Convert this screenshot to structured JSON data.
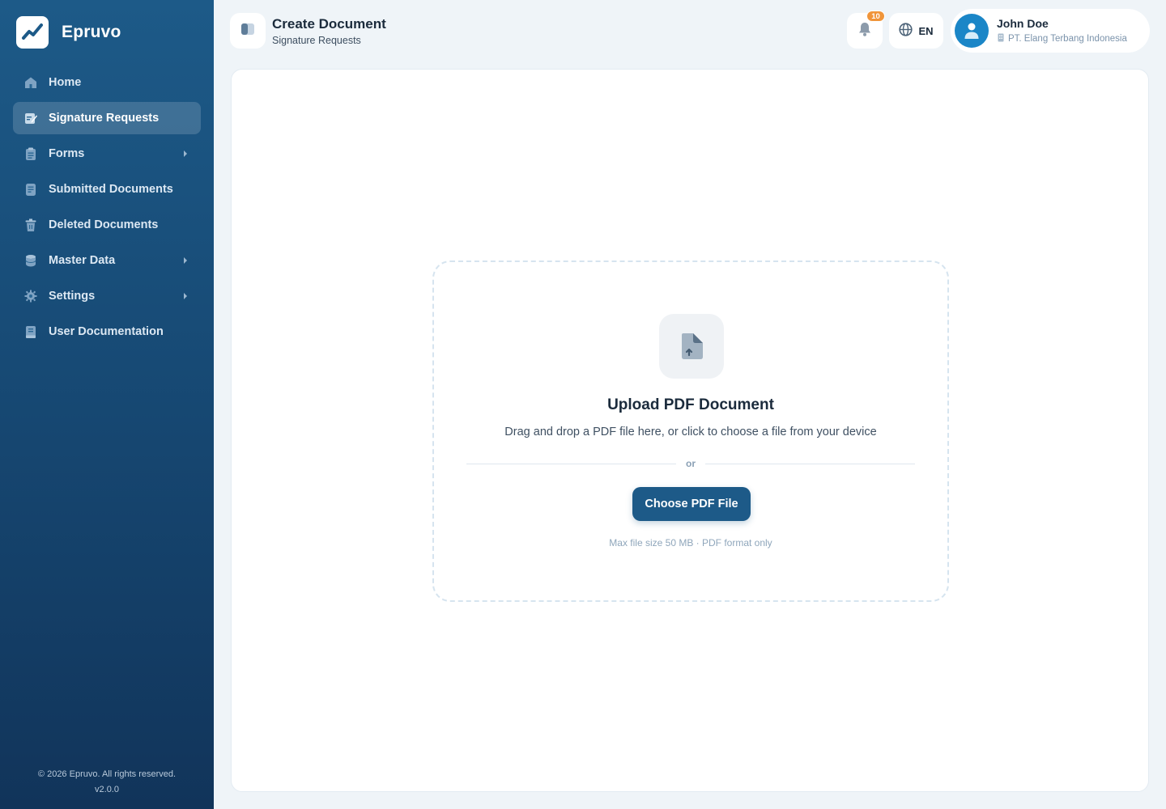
{
  "brand": {
    "name": "Epruvo"
  },
  "sidebar": {
    "items": [
      {
        "label": "Home",
        "icon": "home-icon",
        "active": false,
        "has_submenu": false
      },
      {
        "label": "Signature Requests",
        "icon": "signature-icon",
        "active": true,
        "has_submenu": false
      },
      {
        "label": "Forms",
        "icon": "clipboard-icon",
        "active": false,
        "has_submenu": true
      },
      {
        "label": "Submitted Documents",
        "icon": "document-icon",
        "active": false,
        "has_submenu": false
      },
      {
        "label": "Deleted Documents",
        "icon": "trash-icon",
        "active": false,
        "has_submenu": false
      },
      {
        "label": "Master Data",
        "icon": "database-icon",
        "active": false,
        "has_submenu": true
      },
      {
        "label": "Settings",
        "icon": "gear-icon",
        "active": false,
        "has_submenu": true
      },
      {
        "label": "User Documentation",
        "icon": "book-icon",
        "active": false,
        "has_submenu": false
      }
    ],
    "footer": {
      "copyright": "© 2026 Epruvo. All rights reserved.",
      "version": "v2.0.0"
    }
  },
  "header": {
    "title": "Create Document",
    "subtitle": "Signature Requests",
    "notifications": {
      "count": "10",
      "icon": "bell-icon"
    },
    "language": {
      "code": "EN",
      "icon": "globe-icon"
    },
    "user": {
      "name": "John Doe",
      "organization": "PT. Elang Terbang Indonesia",
      "icon": "building-icon"
    }
  },
  "upload": {
    "icon": "file-upload-icon",
    "title": "Upload PDF Document",
    "description": "Drag and drop a PDF file here, or click to choose a file from your device",
    "divider_text": "or",
    "button_label": "Choose PDF File",
    "note": "Max file size 50 MB · PDF format only"
  },
  "colors": {
    "sidebar_top": "#1d5a88",
    "sidebar_bottom": "#11345a",
    "primary": "#1d5a88",
    "badge": "#f0953a",
    "avatar": "#1b86c7",
    "page_bg": "#eff4f8"
  }
}
